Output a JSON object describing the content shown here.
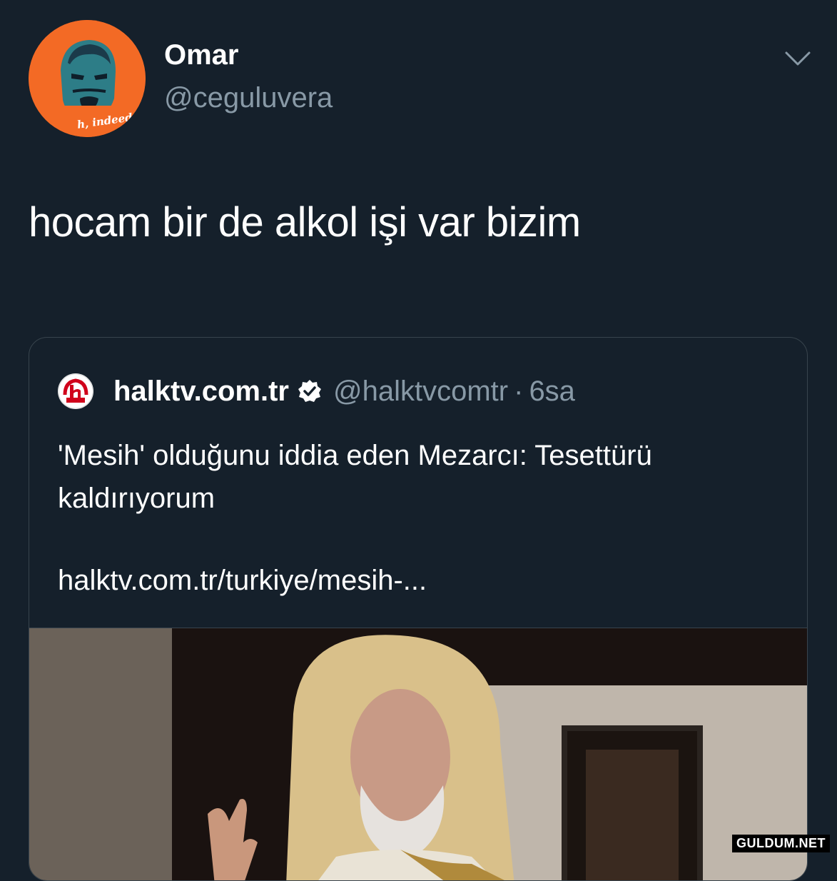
{
  "tweet": {
    "author_name": "Omar",
    "author_handle": "@ceguluvera",
    "avatar_caption": "h, indeed",
    "text": "hocam bir de alkol işi var bizim"
  },
  "quote": {
    "name": "halktv.com.tr",
    "handle": "@halktvcomtr",
    "separator": "·",
    "time": "6sa",
    "title": "'Mesih' olduğunu iddia eden Mezarcı: Tesettürü kaldırıyorum",
    "link": "halktv.com.tr/turkiye/mesih-..."
  },
  "watermark": "GULDUM.NET",
  "colors": {
    "background": "#15202b",
    "secondary_text": "#8899a6",
    "avatar_bg": "#f36a25",
    "border": "#38444d"
  }
}
